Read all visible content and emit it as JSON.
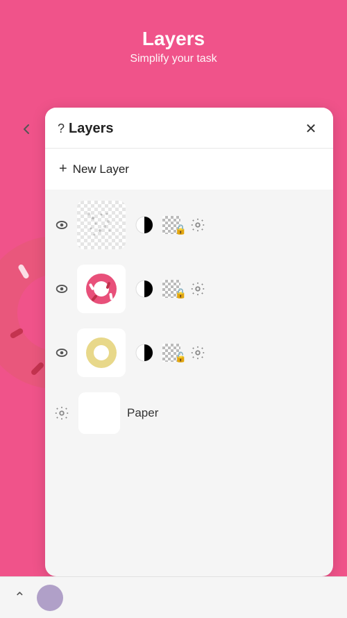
{
  "header": {
    "title": "Layers",
    "subtitle": "Simplify your task"
  },
  "panel": {
    "help_label": "?",
    "title": "Layers",
    "close_label": "✕",
    "new_layer_label": "New Layer",
    "new_layer_plus": "+"
  },
  "layers": [
    {
      "id": 1,
      "visible": true,
      "type": "dots",
      "has_content": true
    },
    {
      "id": 2,
      "visible": true,
      "type": "donut",
      "has_content": true
    },
    {
      "id": 3,
      "visible": true,
      "type": "circle_yellow",
      "has_content": true
    }
  ],
  "paper": {
    "label": "Paper"
  },
  "bottom": {
    "chevron_label": "^"
  },
  "colors": {
    "background": "#F0538A",
    "panel_bg": "#f5f5f5",
    "accent": "#F0538A"
  }
}
